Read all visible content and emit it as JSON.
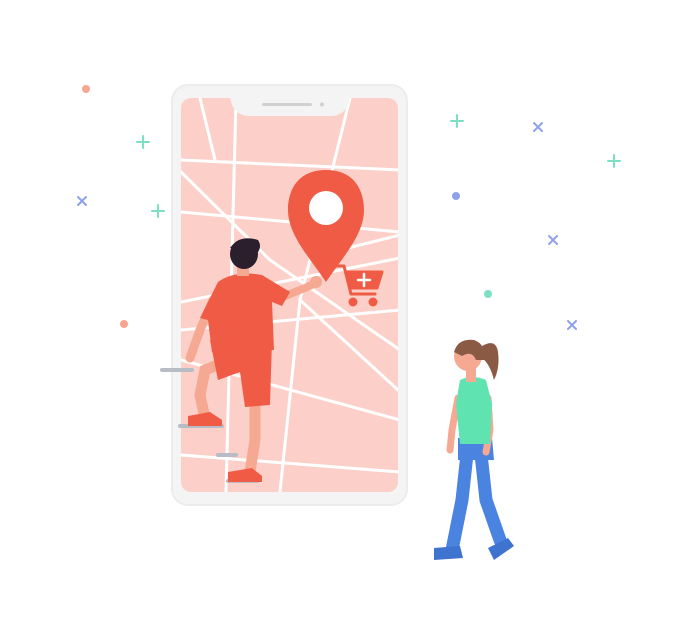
{
  "illustration": {
    "subject": "",
    "colors": {
      "map_background": "#fcd0c8",
      "phone_frame": "#f4f4f4",
      "road": "#ffffff",
      "accent_red": "#ef5b45",
      "pin_inner": "#ffffff",
      "skin": "#f6a992",
      "hair_dark": "#2b1f2e",
      "hair_brown": "#8a5a44",
      "shirt_green": "#5fe3b0",
      "pants_blue": "#4a84e0",
      "shoe_blue": "#3e73cf",
      "step_gray": "#b8bcc4",
      "confetti_green": "#7ee0c3",
      "confetti_blue": "#8fa2e8",
      "confetti_orange": "#f6a590"
    },
    "icons": [
      "location-pin-icon",
      "shopping-cart-plus-icon"
    ]
  }
}
